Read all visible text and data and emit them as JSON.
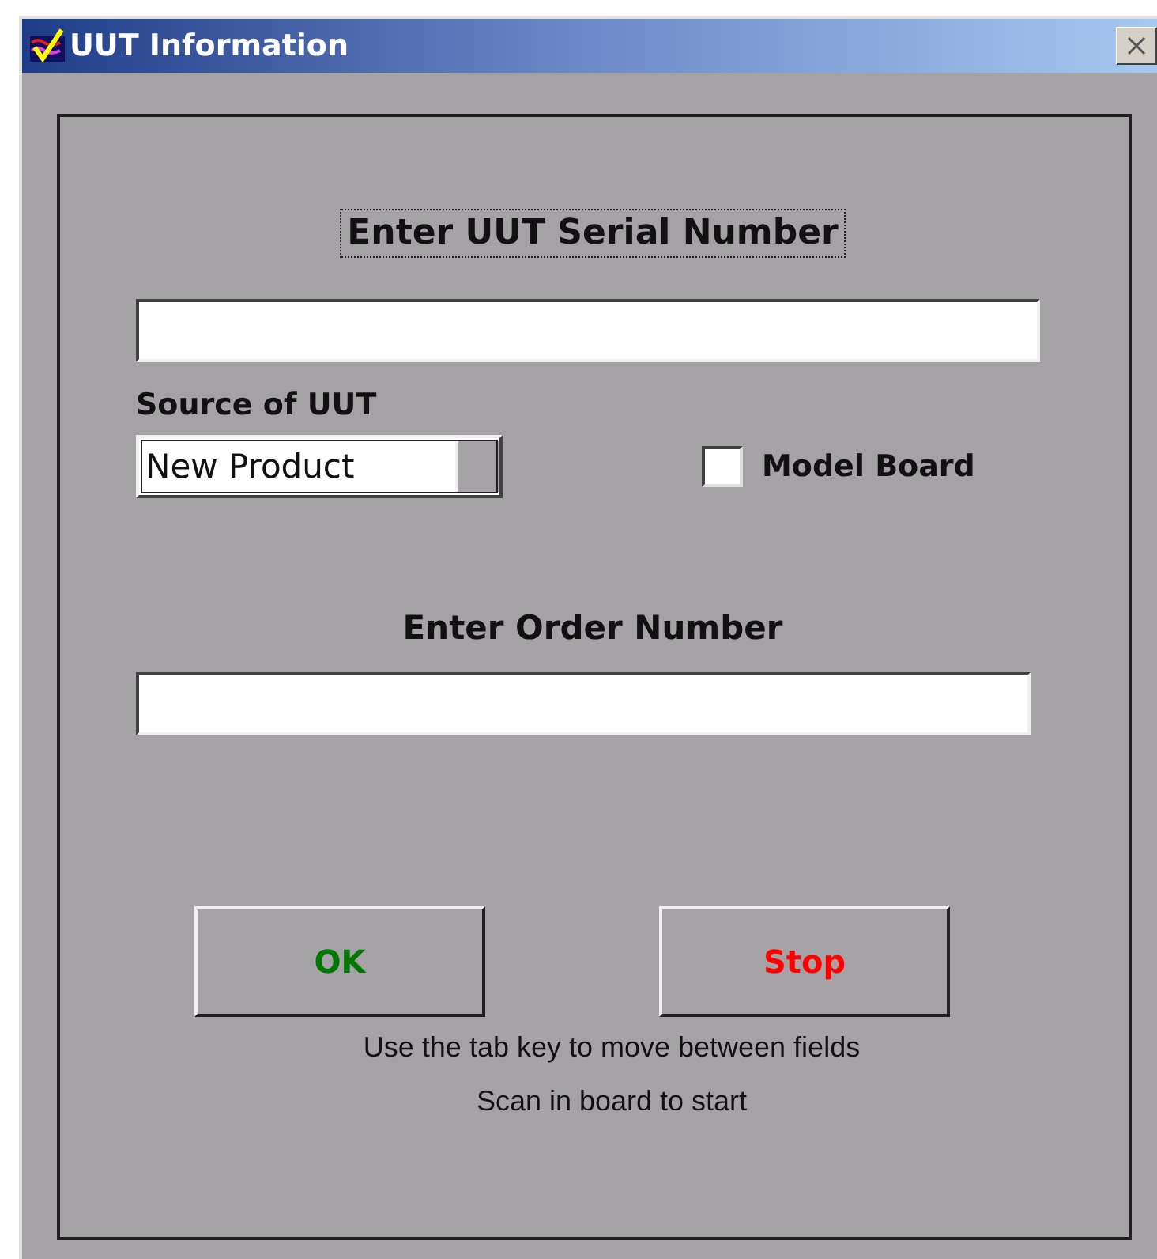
{
  "window": {
    "title": "UUT Information"
  },
  "serial": {
    "label": "Enter UUT Serial Number"
  },
  "source": {
    "label": "Source of UUT",
    "value": "New Product"
  },
  "model_board": {
    "label": "Model Board",
    "checked": false
  },
  "order": {
    "label": "Enter Order Number"
  },
  "buttons": [
    {
      "label": "OK",
      "color": "#007800"
    },
    {
      "label": "Stop",
      "color": "#ff0000"
    }
  ],
  "hints": [
    "Use the tab key to move between fields",
    "Scan in board to start"
  ]
}
